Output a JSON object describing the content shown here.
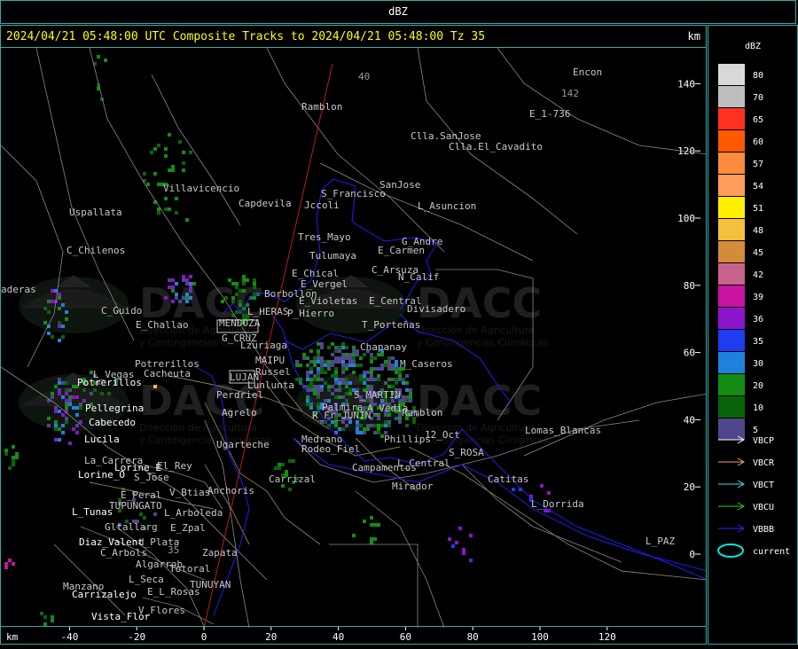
{
  "header": {
    "title": "dBZ"
  },
  "titlebar": {
    "text": "2024/04/21 05:48:00 UTC Composite Tracks to 2024/04/21 05:48:00 Tz 35",
    "km": "km"
  },
  "axes": {
    "x_unit": "km",
    "x_ticks": [
      "-40",
      "-20",
      "0",
      "20",
      "40",
      "60",
      "80",
      "100",
      "120"
    ],
    "y_ticks": [
      "140",
      "120",
      "100",
      "80",
      "60",
      "40",
      "20",
      "0"
    ]
  },
  "scale": {
    "title": "dBZ",
    "items": [
      {
        "value": "80",
        "color": "#d9d9d9"
      },
      {
        "value": "70",
        "color": "#bebebe"
      },
      {
        "value": "65",
        "color": "#ff3020"
      },
      {
        "value": "60",
        "color": "#ff5a00"
      },
      {
        "value": "57",
        "color": "#ff8c3c"
      },
      {
        "value": "54",
        "color": "#ff9e5a"
      },
      {
        "value": "51",
        "color": "#fff000"
      },
      {
        "value": "48",
        "color": "#f5c03c"
      },
      {
        "value": "45",
        "color": "#d28c3c"
      },
      {
        "value": "42",
        "color": "#c8648c"
      },
      {
        "value": "39",
        "color": "#c814a0"
      },
      {
        "value": "36",
        "color": "#8c14c8"
      },
      {
        "value": "35",
        "color": "#1e3cf0"
      },
      {
        "value": "30",
        "color": "#1e82dc"
      },
      {
        "value": "20",
        "color": "#148c14"
      },
      {
        "value": "10",
        "color": "#0a640a"
      },
      {
        "value": "5",
        "color": "#50468c"
      }
    ],
    "tracks": [
      {
        "name": "VBCP",
        "color": "#ffffff"
      },
      {
        "name": "VBCR",
        "color": "#ffa078"
      },
      {
        "name": "VBCT",
        "color": "#32e6e6"
      },
      {
        "name": "VBCU",
        "color": "#32c832"
      },
      {
        "name": "VBBB",
        "color": "#2828ff"
      },
      {
        "name": "current",
        "color": "#00e6e6"
      }
    ]
  },
  "watermark": {
    "brand": "DACC",
    "line1": "Dirección de Agricultura",
    "line2": "y Contingencias Climáticas"
  },
  "places": [
    {
      "name": "Ramblon",
      "color": "#c8c8c8"
    },
    {
      "name": "Encon",
      "color": "#c8c8c8"
    },
    {
      "name": "142",
      "color": "#9a9a9a"
    },
    {
      "name": "E_1-736",
      "color": "#c8c8c8"
    },
    {
      "name": "Clla.SanJose",
      "color": "#c8c8c8"
    },
    {
      "name": "Clla.El_Cavadito",
      "color": "#c8c8c8"
    },
    {
      "name": "Villavicencio",
      "color": "#c8c8c8"
    },
    {
      "name": "Capdevila",
      "color": "#c8c8c8"
    },
    {
      "name": "S_Francisco",
      "color": "#c8c8c8"
    },
    {
      "name": "SanJose",
      "color": "#c8c8c8"
    },
    {
      "name": "Jccoli",
      "color": "#c8c8c8"
    },
    {
      "name": "L_Asuncion",
      "color": "#c8c8c8"
    },
    {
      "name": "Uspallata",
      "color": "#c8c8c8"
    },
    {
      "name": "Tres_Mayo",
      "color": "#c8c8c8"
    },
    {
      "name": "G_Andre",
      "color": "#c8c8c8"
    },
    {
      "name": "Tulumaya",
      "color": "#c8c8c8"
    },
    {
      "name": "E_Carmen",
      "color": "#c8c8c8"
    },
    {
      "name": "C_Chilenos",
      "color": "#c8c8c8"
    },
    {
      "name": "E_Chical",
      "color": "#c8c8c8"
    },
    {
      "name": "C_Arsuza",
      "color": "#c8c8c8"
    },
    {
      "name": "E_Vergel",
      "color": "#c8c8c8"
    },
    {
      "name": "N_Calif",
      "color": "#c8c8c8"
    },
    {
      "name": "Borbollon",
      "color": "#c8c8c8"
    },
    {
      "name": "E_Violetas",
      "color": "#c8c8c8"
    },
    {
      "name": "E_Central",
      "color": "#c8c8c8"
    },
    {
      "name": "Divisadero",
      "color": "#c8c8c8"
    },
    {
      "name": "C_Guido",
      "color": "#c8c8c8"
    },
    {
      "name": "L_HERAS",
      "color": "#c8c8c8"
    },
    {
      "name": "P_Hierro",
      "color": "#c8c8c8"
    },
    {
      "name": "MENDOZA",
      "color": "#c8c8c8"
    },
    {
      "name": "E_Challao",
      "color": "#c8c8c8"
    },
    {
      "name": "T_Porteñas",
      "color": "#c8c8c8"
    },
    {
      "name": "G_CRUZ",
      "color": "#c8c8c8"
    },
    {
      "name": "Chapanay",
      "color": "#c8c8c8"
    },
    {
      "name": "Lzuriaga",
      "color": "#c8c8c8"
    },
    {
      "name": "Potrerillos",
      "color": "#c8c8c8"
    },
    {
      "name": "MAIPU",
      "color": "#c8c8c8"
    },
    {
      "name": "M_Caseros",
      "color": "#c8c8c8"
    },
    {
      "name": "Russel",
      "color": "#c8c8c8"
    },
    {
      "name": "L_Vegas",
      "color": "#c8c8c8"
    },
    {
      "name": "Cacheuta",
      "color": "#c8c8c8"
    },
    {
      "name": "LUJAN",
      "color": "#c8c8c8"
    },
    {
      "name": "Lunlunta",
      "color": "#c8c8c8"
    },
    {
      "name": "Potrerillos",
      "color": "#ffffff"
    },
    {
      "name": "S_MARTIN",
      "color": "#c8c8c8"
    },
    {
      "name": "Perdriel",
      "color": "#c8c8c8"
    },
    {
      "name": "Palmira",
      "color": "#c8c8c8"
    },
    {
      "name": "Pellegrina",
      "color": "#ffffff"
    },
    {
      "name": "Agrelo",
      "color": "#c8c8c8"
    },
    {
      "name": "Ramblon",
      "color": "#c8c8c8"
    },
    {
      "name": "A_Vedia",
      "color": "#c8c8c8"
    },
    {
      "name": "R_Fr_JUNIN",
      "color": "#c8c8c8"
    },
    {
      "name": "Cabecedo",
      "color": "#ffffff"
    },
    {
      "name": "12_Oct",
      "color": "#c8c8c8"
    },
    {
      "name": "Lomas_Blancas",
      "color": "#c8c8c8"
    },
    {
      "name": "Medrano",
      "color": "#c8c8c8"
    },
    {
      "name": "Phillips",
      "color": "#c8c8c8"
    },
    {
      "name": "Lucila",
      "color": "#ffffff"
    },
    {
      "name": "Ugarteche",
      "color": "#c8c8c8"
    },
    {
      "name": "Rodeo_Fiel",
      "color": "#c8c8c8"
    },
    {
      "name": "S_ROSA",
      "color": "#c8c8c8"
    },
    {
      "name": "La_Carrera",
      "color": "#c8c8c8"
    },
    {
      "name": "Lorine_E",
      "color": "#ffffff"
    },
    {
      "name": "El_Rey",
      "color": "#c8c8c8"
    },
    {
      "name": "Campamentos",
      "color": "#c8c8c8"
    },
    {
      "name": "L_Central",
      "color": "#c8c8c8"
    },
    {
      "name": "Lorine_O",
      "color": "#ffffff"
    },
    {
      "name": "S_Jose",
      "color": "#c8c8c8"
    },
    {
      "name": "Carrizal",
      "color": "#c8c8c8"
    },
    {
      "name": "Catitas",
      "color": "#c8c8c8"
    },
    {
      "name": "Mirador",
      "color": "#c8c8c8"
    },
    {
      "name": "Anchoris",
      "color": "#c8c8c8"
    },
    {
      "name": "E_Peral",
      "color": "#c8c8c8"
    },
    {
      "name": "V_Btias",
      "color": "#c8c8c8"
    },
    {
      "name": "TUPUNGATO",
      "color": "#c8c8c8"
    },
    {
      "name": "L_Dorrida",
      "color": "#c8c8c8"
    },
    {
      "name": "L_Tunas",
      "color": "#ffffff"
    },
    {
      "name": "L_Arboleda",
      "color": "#c8c8c8"
    },
    {
      "name": "Gltallarg",
      "color": "#c8c8c8"
    },
    {
      "name": "E_Zpal",
      "color": "#c8c8c8"
    },
    {
      "name": "Diaz_Valent",
      "color": "#ffffff"
    },
    {
      "name": "d_Plata",
      "color": "#c8c8c8"
    },
    {
      "name": "L_PAZ",
      "color": "#c8c8c8"
    },
    {
      "name": "C_Arbols",
      "color": "#c8c8c8"
    },
    {
      "name": "Zapata",
      "color": "#c8c8c8"
    },
    {
      "name": "Algarrob",
      "color": "#c8c8c8"
    },
    {
      "name": "Totoral",
      "color": "#c8c8c8"
    },
    {
      "name": "L_Seca",
      "color": "#c8c8c8"
    },
    {
      "name": "TUNUYAN",
      "color": "#c8c8c8"
    },
    {
      "name": "Manzano",
      "color": "#c8c8c8"
    },
    {
      "name": "E_L_Rosas",
      "color": "#c8c8c8"
    },
    {
      "name": "Carrizalejo",
      "color": "#ffffff"
    },
    {
      "name": "V_Flores",
      "color": "#c8c8c8"
    },
    {
      "name": "Vista_Flor",
      "color": "#ffffff"
    },
    {
      "name": "aderas",
      "color": "#c8c8c8"
    },
    {
      "name": "35",
      "color": "#9a9a9a"
    },
    {
      "name": "40",
      "color": "#9a9a9a"
    }
  ]
}
